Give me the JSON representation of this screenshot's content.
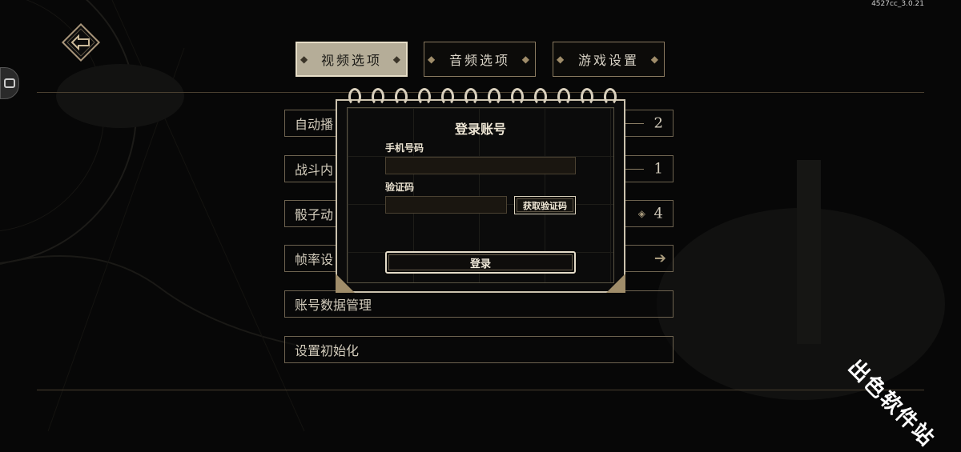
{
  "version": "4527cc_3.0.21",
  "nav": {
    "back_icon": "back-arrow-icon"
  },
  "tabs": [
    {
      "label": "视频选项",
      "active": true
    },
    {
      "label": "音频选项",
      "active": false
    },
    {
      "label": "游戏设置",
      "active": false
    }
  ],
  "settings": [
    {
      "label": "自动播",
      "value": "2"
    },
    {
      "label": "战斗内",
      "value": "1"
    },
    {
      "label": "骰子动",
      "value": "4"
    },
    {
      "label": "帧率设",
      "value": ""
    },
    {
      "label": "账号数据管理",
      "value": ""
    },
    {
      "label": "设置初始化",
      "value": ""
    }
  ],
  "login_modal": {
    "title": "登录账号",
    "phone_label": "手机号码",
    "phone_value": "",
    "code_label": "验证码",
    "code_value": "",
    "get_code_button": "获取验证码",
    "login_button": "登录"
  },
  "watermark": "出色软件站",
  "colors": {
    "accent": "#b5ad98",
    "border": "#6e6350",
    "background": "#070707"
  }
}
